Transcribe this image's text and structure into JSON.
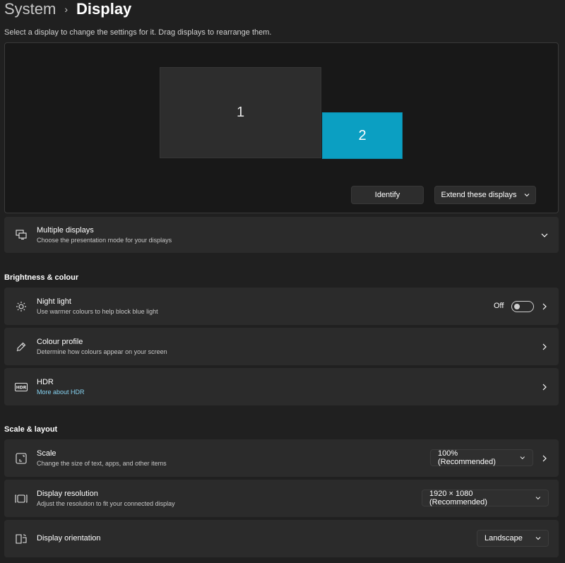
{
  "breadcrumb": {
    "parent": "System",
    "separator": "›",
    "current": "Display"
  },
  "instruction": "Select a display to change the settings for it. Drag displays to rearrange them.",
  "monitors": [
    {
      "label": "1",
      "selected": false
    },
    {
      "label": "2",
      "selected": true,
      "color": "#0b9fc2"
    }
  ],
  "arrange_actions": {
    "identify": "Identify",
    "extend": "Extend these displays"
  },
  "multiple_displays": {
    "title": "Multiple displays",
    "subtitle": "Choose the presentation mode for your displays",
    "icon": "multiple-displays-icon"
  },
  "sections": {
    "brightness": "Brightness & colour",
    "scale_layout": "Scale & layout"
  },
  "night_light": {
    "title": "Night light",
    "subtitle": "Use warmer colours to help block blue light",
    "state_label": "Off",
    "enabled": false,
    "icon": "sun-icon"
  },
  "colour_profile": {
    "title": "Colour profile",
    "subtitle": "Determine how colours appear on your screen",
    "icon": "eyedropper-icon"
  },
  "hdr": {
    "title": "HDR",
    "link": "More about HDR",
    "icon": "hdr-icon",
    "link_color": "#86d2f0"
  },
  "scale": {
    "title": "Scale",
    "subtitle": "Change the size of text, apps, and other items",
    "value": "100% (Recommended)",
    "icon": "scale-icon"
  },
  "resolution": {
    "title": "Display resolution",
    "subtitle": "Adjust the resolution to fit your connected display",
    "value": "1920 × 1080 (Recommended)",
    "icon": "resolution-icon"
  },
  "orientation": {
    "title": "Display orientation",
    "value": "Landscape",
    "icon": "orientation-icon"
  },
  "accent_color": "#0b9fc2"
}
